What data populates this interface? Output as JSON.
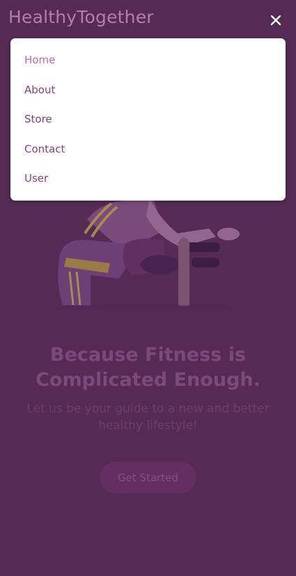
{
  "header": {
    "brand": "HealthyTogether",
    "close_icon": "close-icon"
  },
  "menu": {
    "items": [
      {
        "label": "Home",
        "active": true
      },
      {
        "label": "About",
        "active": false
      },
      {
        "label": "Store",
        "active": false
      },
      {
        "label": "Contact",
        "active": false
      },
      {
        "label": "User",
        "active": false
      }
    ]
  },
  "hero": {
    "title": "Because Fitness is Complicated Enough.",
    "subtitle": "Let us be your guide to a new and better healthy lifestyle!",
    "cta_label": "Get Started"
  },
  "colors": {
    "background": "#552a55",
    "menu_bg": "#ffffff",
    "menu_text": "#8a3f86",
    "menu_active": "#c067b8"
  }
}
